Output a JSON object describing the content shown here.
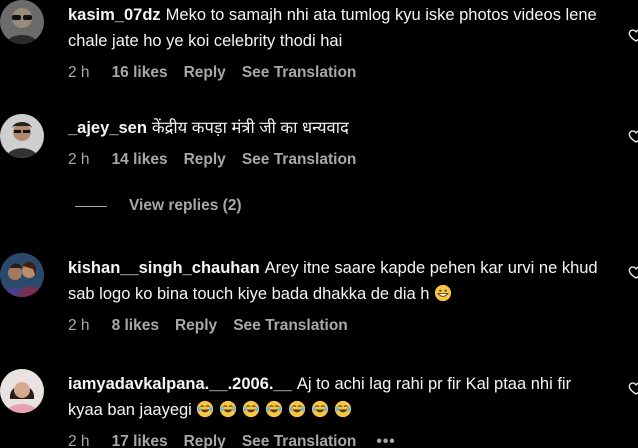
{
  "colors": {
    "background": "#000000",
    "text": "#f5f5f5",
    "muted": "#a8a8a8"
  },
  "comments": [
    {
      "username": "kasim_07dz",
      "text": "Meko to samajh nhi ata tumlog kyu iske photos videos lene chale jate ho ye koi celebrity thodi hai",
      "time": "2 h",
      "likes": "16 likes",
      "reply": "Reply",
      "translate": "See Translation",
      "avatar_icon": "sunglasses-avatar"
    },
    {
      "username": "_ajey_sen",
      "text": "केंद्रीय कपड़ा मंत्री जी का धन्यवाद",
      "time": "2 h",
      "likes": "14 likes",
      "reply": "Reply",
      "translate": "See Translation",
      "avatar_icon": "person-avatar"
    },
    {
      "username": "kishan__singh_chauhan",
      "text": "Arey itne saare kapde pehen kar urvi ne khud sab logo ko bina touch kiye bada dhakka de dia h",
      "time": "2 h",
      "likes": "8 likes",
      "reply": "Reply",
      "translate": "See Translation",
      "avatar_icon": "couple-avatar",
      "emojis": [
        "grinning-face-emoji"
      ]
    },
    {
      "username": "iamyadavkalpana.__.2006.__",
      "text": "Aj to achi lag rahi pr fir Kal ptaa nhi fir kyaa ban jaayegi",
      "time": "2 h",
      "likes": "17 likes",
      "reply": "Reply",
      "translate": "See Translation",
      "more": "•••",
      "avatar_icon": "woman-avatar",
      "emojis": [
        "tears-of-joy-emoji",
        "tears-of-joy-emoji",
        "tears-of-joy-emoji",
        "tears-of-joy-emoji",
        "tears-of-joy-emoji",
        "tears-of-joy-emoji",
        "tears-of-joy-emoji"
      ]
    }
  ],
  "view_replies": "View replies (2)"
}
